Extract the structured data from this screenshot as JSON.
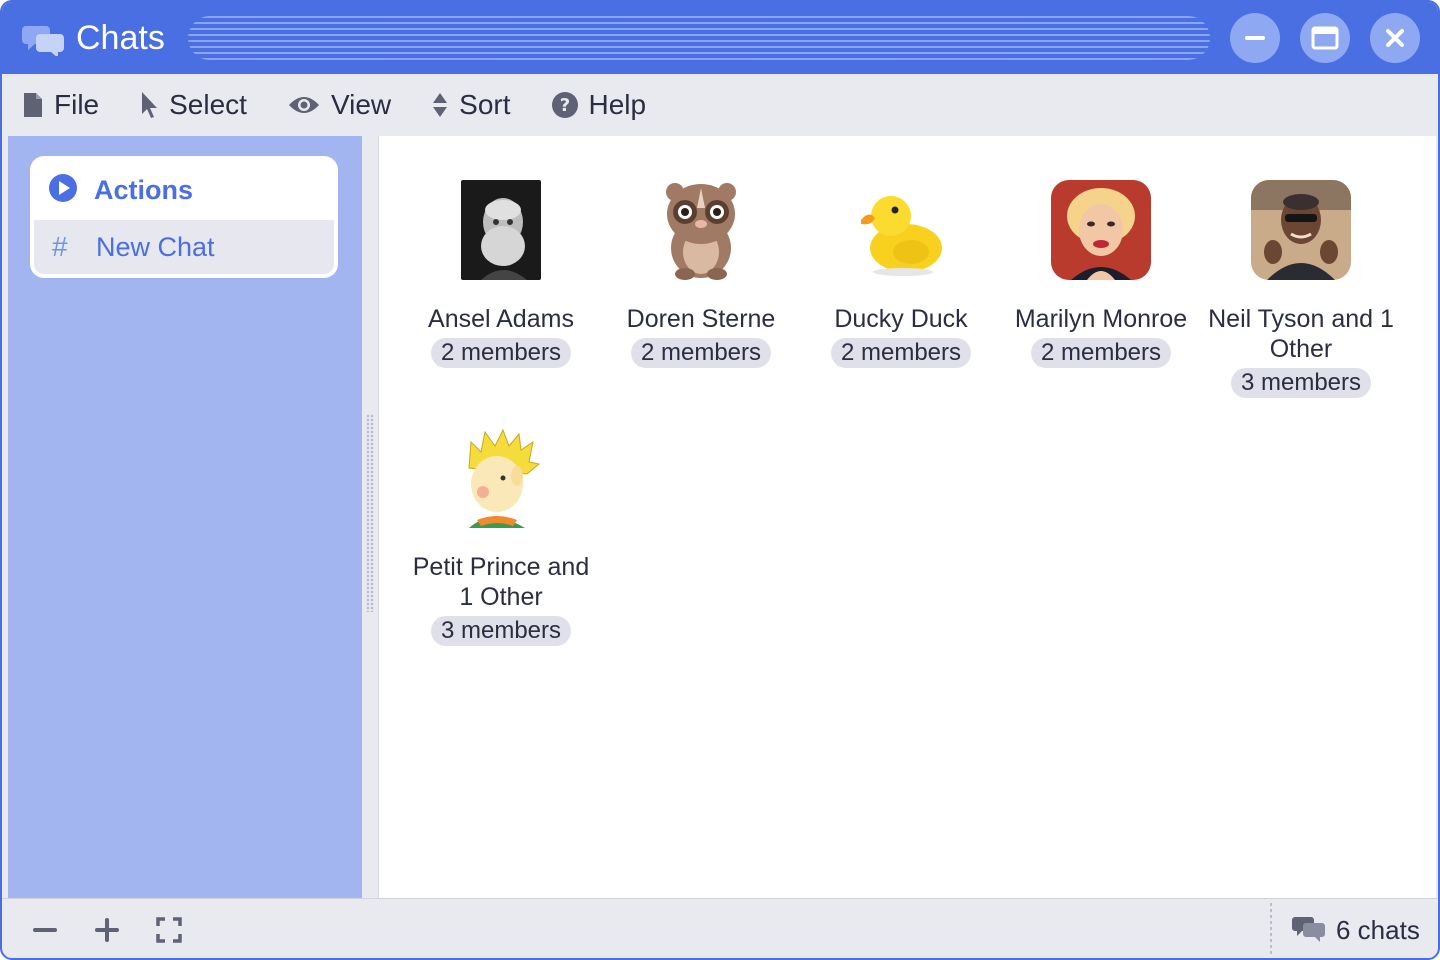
{
  "window": {
    "title": "Chats",
    "icon": "chat-bubbles-icon",
    "controls": [
      "minimize-icon",
      "maximize-icon",
      "close-icon"
    ],
    "accent_color": "#4a6fe3"
  },
  "menu": {
    "items": [
      {
        "label": "File",
        "icon": "file-icon"
      },
      {
        "label": "Select",
        "icon": "cursor-icon"
      },
      {
        "label": "View",
        "icon": "eye-icon"
      },
      {
        "label": "Sort",
        "icon": "sort-icon"
      },
      {
        "label": "Help",
        "icon": "help-icon"
      }
    ]
  },
  "sidebar": {
    "background": "#a3b5f0",
    "actions_label": "Actions",
    "new_chat_label": "New Chat"
  },
  "chats": [
    {
      "name": "Ansel Adams",
      "members": "2 members",
      "avatar": "portrait-photo"
    },
    {
      "name": "Doren Sterne",
      "members": "2 members",
      "avatar": "loris-cartoon"
    },
    {
      "name": "Ducky Duck",
      "members": "2 members",
      "avatar": "rubber-duck"
    },
    {
      "name": "Marilyn Monroe",
      "members": "2 members",
      "avatar": "portrait-photo"
    },
    {
      "name": "Neil Tyson and 1 Other",
      "members": "3 members",
      "avatar": "portrait-photo"
    },
    {
      "name": "Petit Prince and 1 Other",
      "members": "3 members",
      "avatar": "little-prince-cartoon"
    }
  ],
  "status": {
    "count_label": "6 chats",
    "buttons": [
      "zoom-out-icon",
      "zoom-in-icon",
      "fullscreen-icon"
    ]
  }
}
